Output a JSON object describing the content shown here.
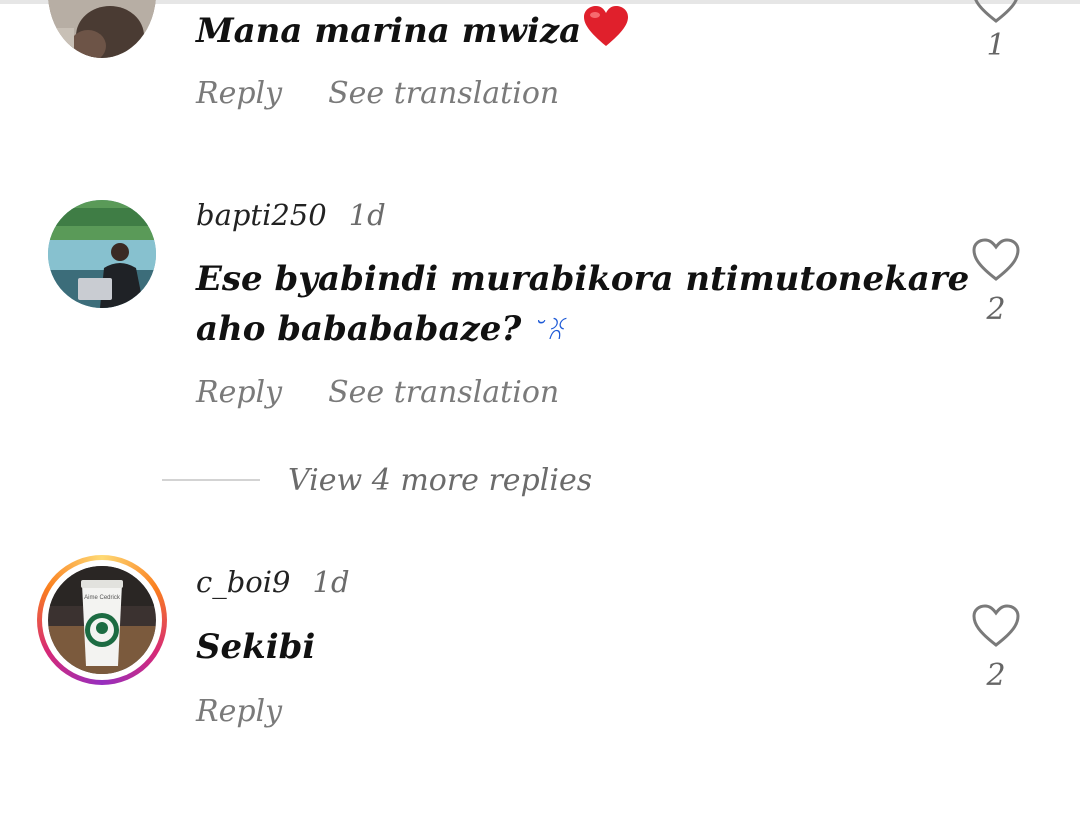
{
  "comments": [
    {
      "username": "",
      "time": "",
      "text": "Mana marina mwiza",
      "emoji": "❤️",
      "reply_label": "Reply",
      "translate_label": "See translation",
      "likes": "1"
    },
    {
      "username": "bapti250",
      "time": "1d",
      "text_line1": "Ese byabindi murabikora ntimutonekare",
      "text_line2": "aho babababaze?",
      "emoji": "˘ꐦ",
      "reply_label": "Reply",
      "translate_label": "See translation",
      "likes": "2"
    },
    {
      "username": "c_boi9",
      "time": "1d",
      "text": "Sekibi",
      "reply_label": "Reply",
      "likes": "2",
      "avatar_caption": "Aime Cedrick"
    }
  ],
  "view_more_label": "View 4 more replies",
  "colors": {
    "heart_red": "#e0202c",
    "story_ring": [
      "#feda75",
      "#fa7e1e",
      "#d62976",
      "#962fbf"
    ],
    "muted_text": "#7a7a7a"
  }
}
